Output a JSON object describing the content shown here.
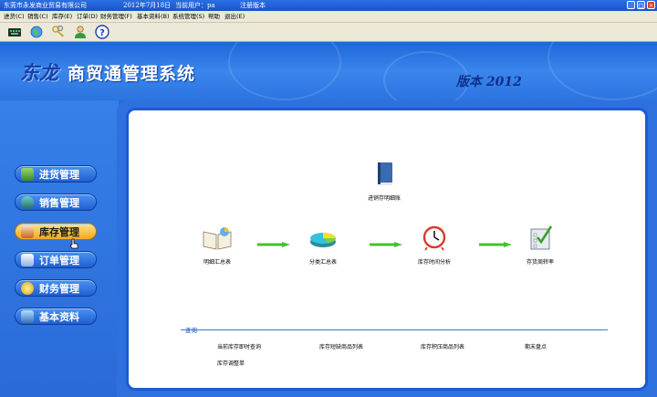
{
  "titlebar": {
    "company": "东莞市永发商业贸易有限公司",
    "date": "2012年7月18日",
    "user": "当前用户：pa",
    "edition": "注册版本"
  },
  "menu": {
    "items": [
      "进货(C)",
      "销售(C)",
      "库存(E)",
      "订单(D)",
      "财务管理(F)",
      "基本资料(B)",
      "系统管理(S)",
      "帮助",
      "退出(E)"
    ]
  },
  "header": {
    "brand_a": "东龙",
    "brand_b": "商贸通管理系统",
    "version": "版本 2012"
  },
  "nav": {
    "items": [
      {
        "label": "进货管理",
        "icon": "purchase-icon",
        "active": false
      },
      {
        "label": "销售管理",
        "icon": "sales-icon",
        "active": false
      },
      {
        "label": "库存管理",
        "icon": "warehouse-icon",
        "active": true
      },
      {
        "label": "订单管理",
        "icon": "order-icon",
        "active": false
      },
      {
        "label": "财务管理",
        "icon": "finance-icon",
        "active": false
      },
      {
        "label": "基本资料",
        "icon": "basic-data-icon",
        "active": false
      }
    ]
  },
  "flow": {
    "top": "进销存明细账",
    "items": [
      "明细汇总表",
      "分类汇总表",
      "库存时间分析",
      "存货周转率"
    ]
  },
  "query": {
    "title": "查询",
    "items": [
      "当前库存即时查询",
      "库存短缺商品列表",
      "库存积压商品列表",
      "期末盘点",
      "库存调整单"
    ]
  },
  "colors": {
    "accent": "#2a6ad8",
    "active_nav": "#f3a81c",
    "arrow": "#48c030"
  }
}
